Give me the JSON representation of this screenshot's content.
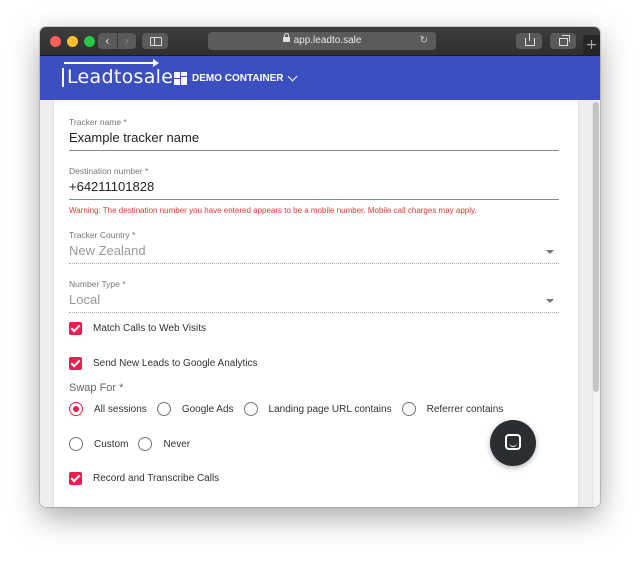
{
  "browser": {
    "url": "app.leadto.sale",
    "nav_back": "‹",
    "nav_forward": "›",
    "new_tab": "+"
  },
  "header": {
    "logo": "Leadtosale",
    "container_label": "DEMO CONTAINER"
  },
  "form": {
    "tracker_name": {
      "label": "Tracker name *",
      "value": "Example tracker name"
    },
    "destination_number": {
      "label": "Destination number *",
      "value": "+64211101828",
      "warning": "Warning: The destination number you have entered appears to be a mobile number. Mobile call charges may apply."
    },
    "tracker_country": {
      "label": "Tracker Country *",
      "value": "New Zealand"
    },
    "number_type": {
      "label": "Number Type *",
      "value": "Local"
    },
    "match_calls": {
      "label": "Match Calls to Web Visits",
      "checked": true
    },
    "send_leads": {
      "label": "Send New Leads to Google Analytics",
      "checked": true
    },
    "swap_for": {
      "label": "Swap For *",
      "options": [
        "All sessions",
        "Google Ads",
        "Landing page URL contains",
        "Referrer contains",
        "Custom",
        "Never"
      ],
      "selected": "All sessions"
    },
    "record_calls": {
      "label": "Record and Transcribe Calls",
      "checked": true
    }
  },
  "colors": {
    "appbar": "#3c4fc0",
    "accent": "#e91e4e",
    "warning": "#e53935"
  },
  "icons": {
    "container": "grid-icon",
    "chat": "chat-icon"
  }
}
